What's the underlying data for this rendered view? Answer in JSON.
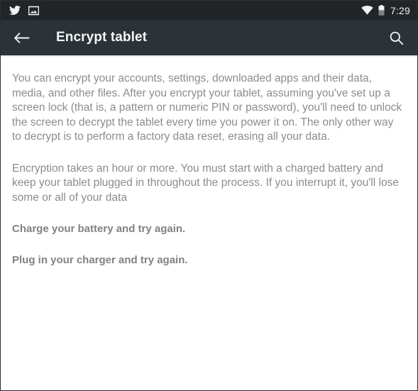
{
  "status_bar": {
    "background_color": "#212528",
    "left_icons": [
      {
        "name": "twitter-notification-icon",
        "label": "Twitter"
      },
      {
        "name": "screenshot-notification-icon",
        "label": "Screenshot"
      }
    ],
    "right_icons": [
      {
        "name": "wifi-icon",
        "label": "Wi-Fi connected"
      },
      {
        "name": "battery-icon",
        "label": "Battery about half",
        "level_percent": 50
      }
    ],
    "clock": "7:29"
  },
  "app_bar": {
    "background_color": "#2b3338",
    "back_label": "Navigate up",
    "title": "Encrypt tablet",
    "search_label": "Search"
  },
  "content": {
    "background_color": "#ffffff",
    "text_color": "#8c8c8c",
    "warning_color": "#828282",
    "paragraphs": [
      "You can encrypt your accounts, settings, downloaded apps and their data, media, and other files. After you encrypt your tablet, assuming you've set up a screen lock (that is, a pattern or numeric PIN or password), you'll need to unlock the screen to decrypt the tablet every time you power it on. The only other way to decrypt is to perform a factory data reset, erasing all your data.",
      "Encryption takes an hour or more. You must start with a charged battery and keep your tablet plugged in throughout the process. If you interrupt it, you'll lose some or all of your data"
    ],
    "warnings": [
      "Charge your battery and try again.",
      "Plug in your charger and try again."
    ]
  }
}
